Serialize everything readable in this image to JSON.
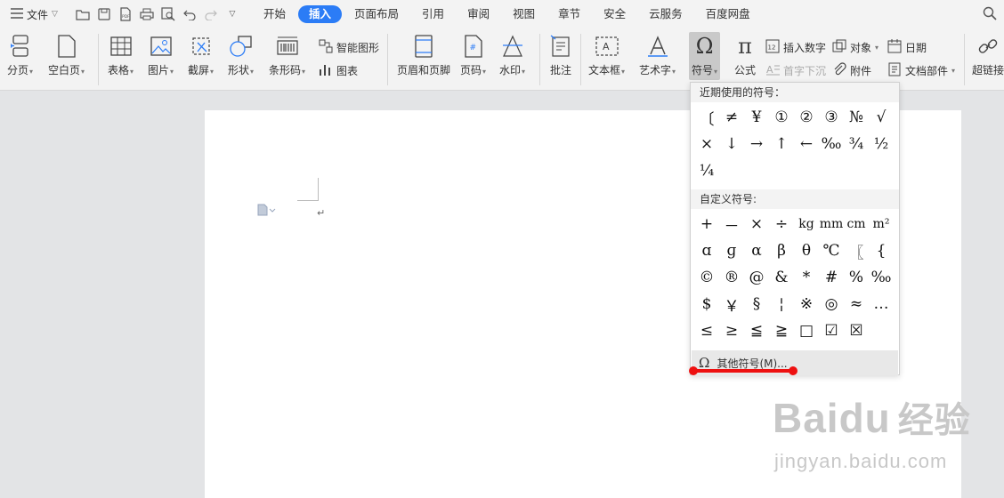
{
  "menubar": {
    "file_label": "文件",
    "tabs": [
      {
        "label": "开始"
      },
      {
        "label": "插入",
        "active": true
      },
      {
        "label": "页面布局"
      },
      {
        "label": "引用"
      },
      {
        "label": "审阅"
      },
      {
        "label": "视图"
      },
      {
        "label": "章节"
      },
      {
        "label": "安全"
      },
      {
        "label": "云服务"
      },
      {
        "label": "百度网盘"
      }
    ],
    "accent": "#2b7cf6"
  },
  "ribbon": {
    "page_break": "分页",
    "blank_page": "空白页",
    "table": "表格",
    "picture": "图片",
    "screenshot": "截屏",
    "shapes": "形状",
    "barcode": "条形码",
    "smart_art": "智能图形",
    "chart": "图表",
    "header_footer": "页眉和页脚",
    "page_number": "页码",
    "watermark": "水印",
    "comment": "批注",
    "textbox": "文本框",
    "wordart": "艺术字",
    "symbol": "符号",
    "formula": "公式",
    "insert_number": "插入数字",
    "drop_cap": "首字下沉",
    "object": "对象",
    "attachment": "附件",
    "date": "日期",
    "doc_parts": "文档部件",
    "hyperlink": "超链接"
  },
  "document": {
    "paragraph_mark": "↵"
  },
  "symbol_dropdown": {
    "recent_header": "近期使用的符号：",
    "recent": [
      "〔",
      "≠",
      "¥",
      "①",
      "②",
      "③",
      "№",
      "√",
      "×",
      "↓",
      "→",
      "↑",
      "←",
      "‰",
      "¾",
      "½",
      "¼"
    ],
    "custom_header": "自定义符号:",
    "custom": [
      "+",
      "－",
      "×",
      "÷",
      "kg",
      "mm",
      "cm",
      "m²",
      "ɑ",
      "ɡ",
      "α",
      "β",
      "θ",
      "℃",
      "〖",
      "{",
      "©",
      "®",
      "@",
      "&",
      "*",
      "#",
      "%",
      "‰",
      "$",
      "￥",
      "§",
      "¦",
      "※",
      "◎",
      "≈",
      "…",
      "≤",
      "≥",
      "≦",
      "≧",
      "□",
      "☑",
      "☒"
    ],
    "more_label": "其他符号(M)..."
  },
  "watermark": {
    "brand": "Baidu",
    "brand_cn": "经验",
    "url": "jingyan.baidu.com"
  }
}
